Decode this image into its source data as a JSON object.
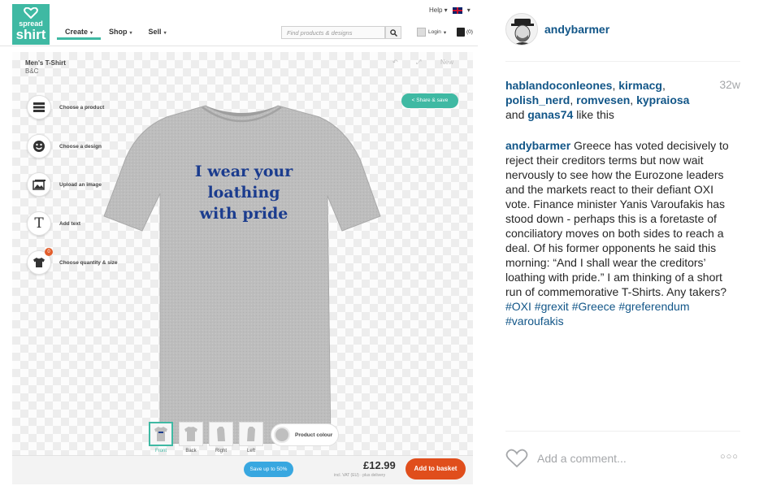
{
  "spreadshirt": {
    "logo": {
      "line1": "spread",
      "line2": "shirt"
    },
    "nav": [
      {
        "label": "Create"
      },
      {
        "label": "Shop"
      },
      {
        "label": "Sell"
      }
    ],
    "help": "Help",
    "search_placeholder": "Find products & designs",
    "login": "Login",
    "cart": "(0)",
    "product_title": "Men's T-Shirt",
    "product_brand": "B&C",
    "new_label": "New",
    "share": "Share & save",
    "tools": [
      {
        "label": "Choose a product"
      },
      {
        "label": "Choose a design"
      },
      {
        "label": "Upload an image"
      },
      {
        "label": "Add text",
        "glyph": "T"
      },
      {
        "label": "Choose quantity & size",
        "badge": "0"
      }
    ],
    "design_text": [
      "I wear your",
      "loathing",
      "with pride"
    ],
    "design_color": "#1b3c8e",
    "views": [
      {
        "label": "Front"
      },
      {
        "label": "Back"
      },
      {
        "label": "Right"
      },
      {
        "label": "Left"
      }
    ],
    "product_colour": "Product colour",
    "save_pill": "Save up to 50%",
    "price": "£12.99",
    "vat": "incl. VAT (EU) · plus delivery",
    "add_to_basket": "Add to basket",
    "accent": "#3fb9a3"
  },
  "post": {
    "username": "andybarmer",
    "age": "32w",
    "likers": [
      "hablandoconleones",
      "kirmacg",
      "polish_nerd",
      "romvesen",
      "kypraiosa"
    ],
    "likers_and": "and",
    "last_liker": "ganas74",
    "likers_suffix": "like this",
    "caption_user": "andybarmer",
    "caption_text": "Greece has voted decisively to reject their creditors terms but now wait nervously to see how the Eurozone leaders and the markets react to their defiant OXI vote. Finance minister Yanis Varoufakis has stood down - perhaps this is a foretaste of conciliatory moves on both sides to reach a deal. Of his former opponents he said this morning: “And I shall wear the creditors’ loathing with pride.” I am thinking of a short run of commemorative T-Shirts. Any takers?",
    "hashtags": [
      "#OXI",
      "#grexit",
      "#Greece",
      "#greferendum",
      "#varoufakis"
    ],
    "comment_placeholder": "Add a comment...",
    "link_color": "#125688"
  }
}
